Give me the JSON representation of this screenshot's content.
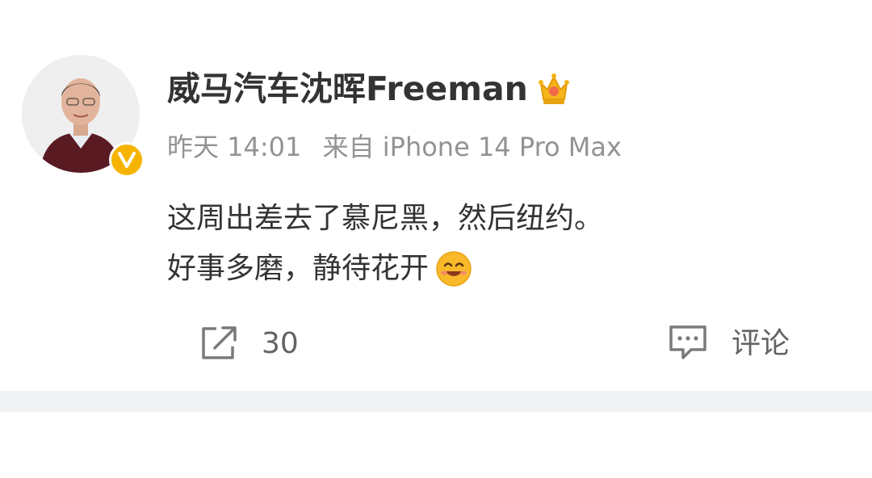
{
  "post": {
    "user_name": "威马汽车沈晖Freeman",
    "time": "昨天 14:01",
    "source": "来自 iPhone 14 Pro Max",
    "text_line_1": "这周出差去了慕尼黑，然后纽约。",
    "text_line_2": "好事多磨，静待花开"
  },
  "actions": {
    "repost_count": "30",
    "comment_label": "评论"
  },
  "icons": {
    "avatar": "avatar-photo",
    "verified": "verified-v-badge-icon",
    "crown": "crown-icon",
    "emoji": "smile-emoji-icon",
    "repost": "share-icon",
    "comment": "comment-icon"
  },
  "colors": {
    "verified_badge": "#f6b400",
    "meta_text": "#939393",
    "action_text": "#636363",
    "divider_band": "#f1f2f5"
  }
}
